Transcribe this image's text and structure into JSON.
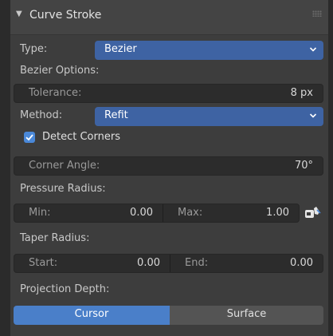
{
  "panel": {
    "title": "Curve Stroke",
    "type_label": "Type:",
    "type_value": "Bezier",
    "bezier_options_label": "Bezier Options:",
    "tolerance_label": "Tolerance:",
    "tolerance_value": "8 px",
    "method_label": "Method:",
    "method_value": "Refit",
    "detect_corners_label": "Detect Corners",
    "detect_corners_checked": true,
    "corner_angle_label": "Corner Angle:",
    "corner_angle_value": "70°",
    "pressure_radius_label": "Pressure Radius:",
    "pressure_min_label": "Min:",
    "pressure_min_value": "0.00",
    "pressure_max_label": "Max:",
    "pressure_max_value": "1.00",
    "taper_radius_label": "Taper Radius:",
    "taper_start_label": "Start:",
    "taper_start_value": "0.00",
    "taper_end_label": "End:",
    "taper_end_value": "0.00",
    "projection_depth_label": "Projection Depth:",
    "projection_options": [
      "Cursor",
      "Surface"
    ],
    "projection_selected": "Cursor"
  },
  "colors": {
    "accent": "#3e63a3",
    "checkbox": "#4a88d8",
    "panel_bg": "#3d3d3d",
    "field_bg": "#2c2c2c"
  },
  "icons": {
    "header_toggle": "triangle-down-icon",
    "drag_grip": "grip-dots-icon",
    "dropdown": "chevron-down-icon",
    "checkbox": "checkmark-icon",
    "pressure_curve": "cursor-hand-icon"
  }
}
